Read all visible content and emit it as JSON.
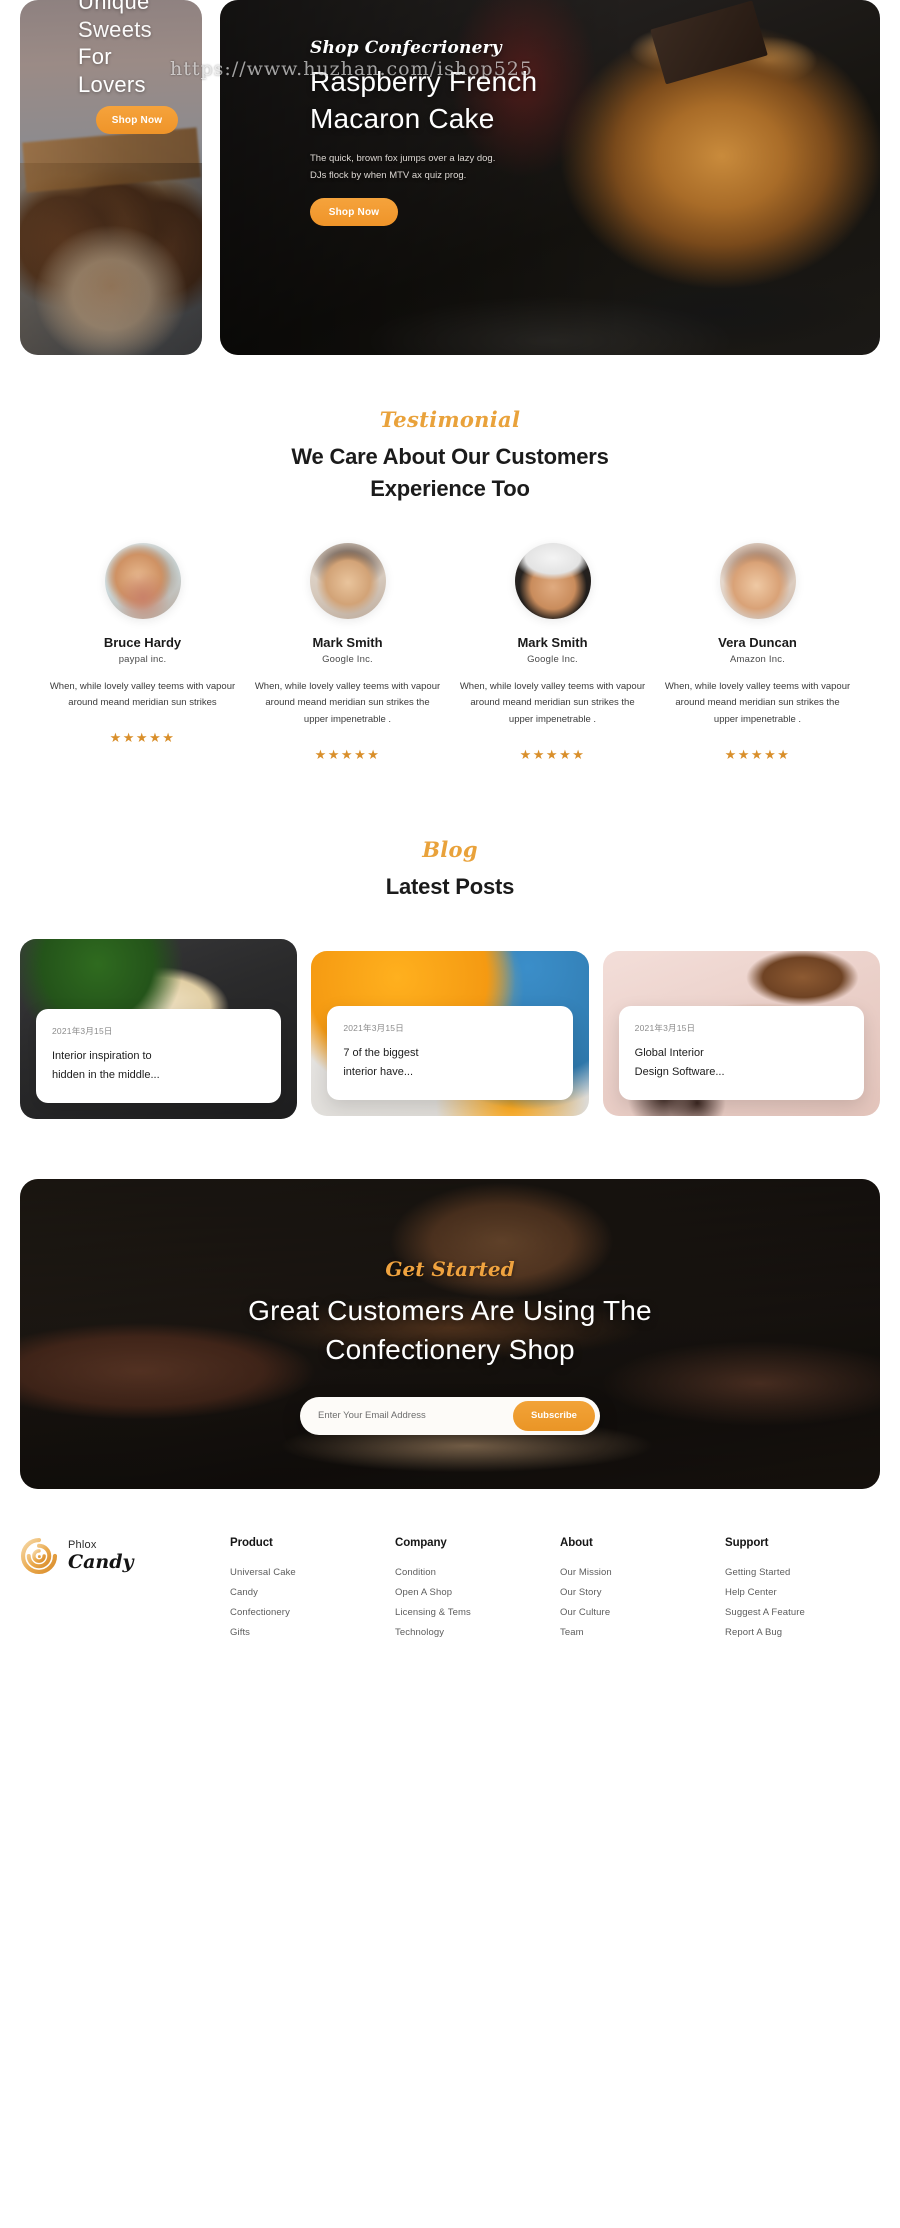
{
  "watermark": "https://www.huzhan.com/ishop525",
  "hero": {
    "left": {
      "line1": "Unique",
      "line2": "Sweets",
      "line3": "For",
      "line4": "Lovers",
      "cta": "Shop Now"
    },
    "right": {
      "eyebrow": "Shop Confecrionery",
      "title_line1": "Raspberry French",
      "title_line2": "Macaron Cake",
      "sub_line1": "The quick, brown fox jumps over a lazy dog.",
      "sub_line2": "DJs flock by when MTV ax quiz prog.",
      "cta": "Shop Now"
    }
  },
  "testimonial": {
    "script_label": "Testimonial",
    "title_line1": "We Care About Our Customers",
    "title_line2": "Experience Too",
    "stars": "★★★★★",
    "cards": [
      {
        "name": "Bruce Hardy",
        "company": "paypal inc.",
        "quote": "When, while lovely valley teems with vapour around meand meridian sun strikes",
        "rating": 5
      },
      {
        "name": "Mark Smith",
        "company": "Google Inc.",
        "quote": "When, while lovely valley teems with vapour around meand meridian sun strikes the upper impenetrable .",
        "rating": 5
      },
      {
        "name": "Mark Smith",
        "company": "Google Inc.",
        "quote": "When, while lovely valley teems with vapour around meand meridian sun strikes the upper impenetrable .",
        "rating": 5
      },
      {
        "name": "Vera Duncan",
        "company": "Amazon Inc.",
        "quote": "When, while lovely valley teems with vapour around meand meridian sun strikes the upper impenetrable .",
        "rating": 5
      }
    ]
  },
  "blog": {
    "script_label": "Blog",
    "title": "Latest Posts",
    "posts": [
      {
        "date": "2021年3月15日",
        "title_line1": "Interior inspiration to",
        "title_line2": "hidden in the middle..."
      },
      {
        "date": "2021年3月15日",
        "title_line1": "7 of the biggest",
        "title_line2": "interior have..."
      },
      {
        "date": "2021年3月15日",
        "title_line1": "Global Interior",
        "title_line2": "Design Software..."
      }
    ]
  },
  "cta": {
    "script_label": "Get Started",
    "title_line1": "Great Customers Are Using The",
    "title_line2": "Confectionery Shop",
    "email_placeholder": "Enter Your Email Address",
    "email_value": "",
    "subscribe_label": "Subscribe"
  },
  "footer": {
    "brand_top": "Phlox",
    "brand_bottom": "Candy",
    "columns": [
      {
        "heading": "Product",
        "links": [
          "Universal Cake",
          "Candy",
          "Confectionery",
          "Gifts"
        ]
      },
      {
        "heading": "Company",
        "links": [
          "Condition",
          "Open A Shop",
          "Licensing & Tems",
          "Technology"
        ]
      },
      {
        "heading": "About",
        "links": [
          "Our Mission",
          "Our Story",
          "Our Culture",
          "Team"
        ]
      },
      {
        "heading": "Support",
        "links": [
          "Getting Started",
          "Help Center",
          "Suggest A Feature",
          "Report A Bug"
        ]
      }
    ]
  },
  "colors": {
    "accent_orange": "#ef9429",
    "script_gold": "#e9a23b",
    "star_gold": "#d98f2b",
    "text_dark": "#1b1b1b",
    "text_muted": "#5d5d5d"
  }
}
